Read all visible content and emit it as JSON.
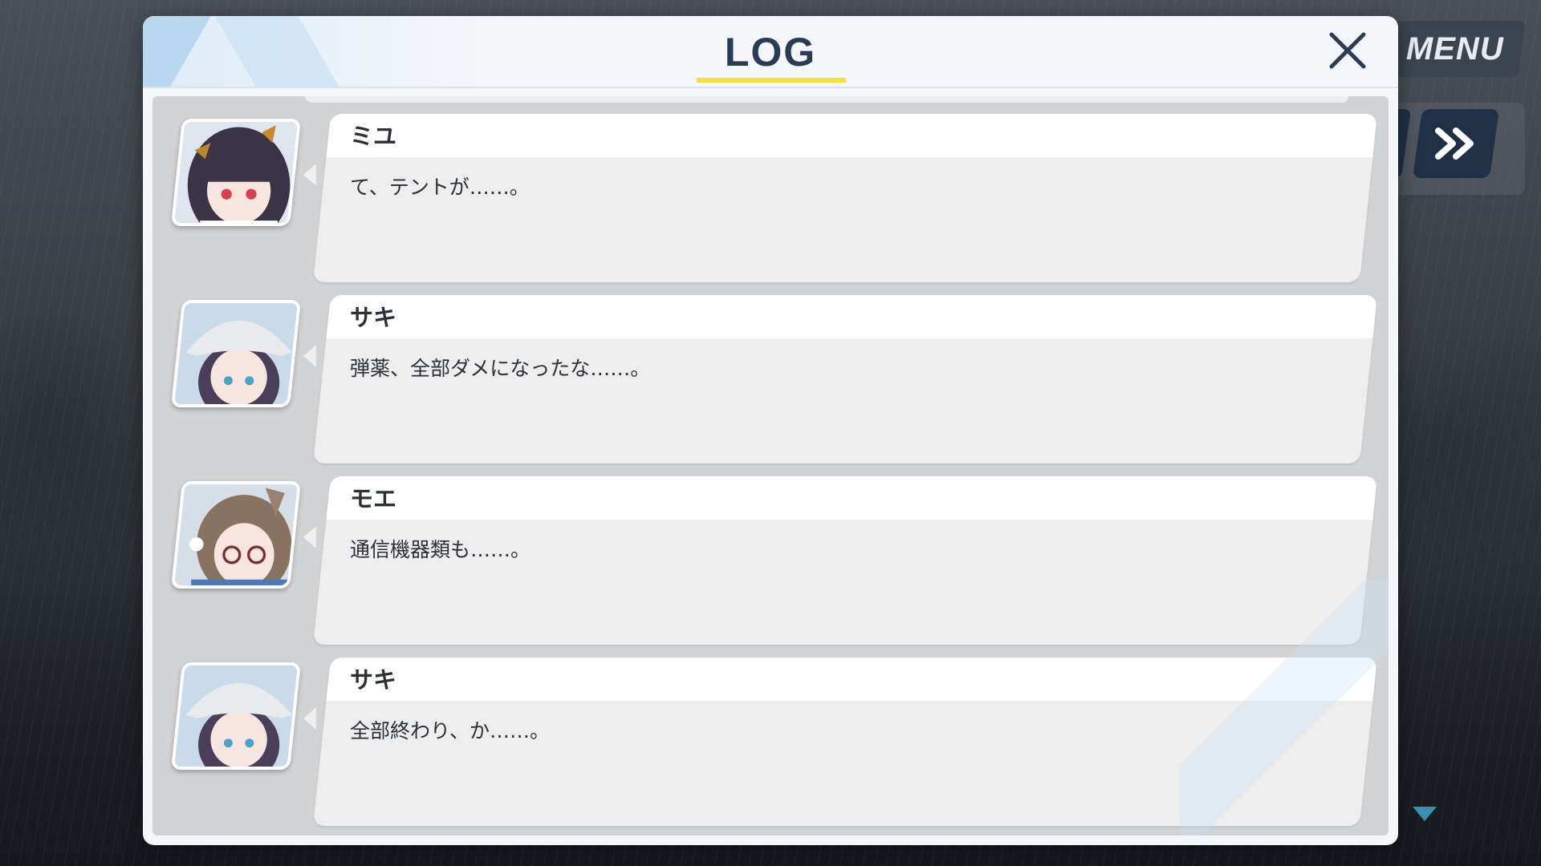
{
  "panel": {
    "title": "LOG",
    "close_icon": "close-icon"
  },
  "hud": {
    "menu_label": "MENU",
    "skip_icon": "fast-forward-icon",
    "more_icon": "triangle-down-icon"
  },
  "colors": {
    "title": "#2a3b55",
    "underline": "#f5e13a",
    "hud_button": "#1f3147"
  },
  "entries": [
    {
      "speaker": "ミユ",
      "text": "て、テントが……。",
      "avatar": "miyu-portrait"
    },
    {
      "speaker": "サキ",
      "text": "弾薬、全部ダメになったな……。",
      "avatar": "saki-portrait"
    },
    {
      "speaker": "モエ",
      "text": "通信機器類も……。",
      "avatar": "moe-portrait"
    },
    {
      "speaker": "サキ",
      "text": "全部終わり、か……。",
      "avatar": "saki-portrait"
    }
  ]
}
